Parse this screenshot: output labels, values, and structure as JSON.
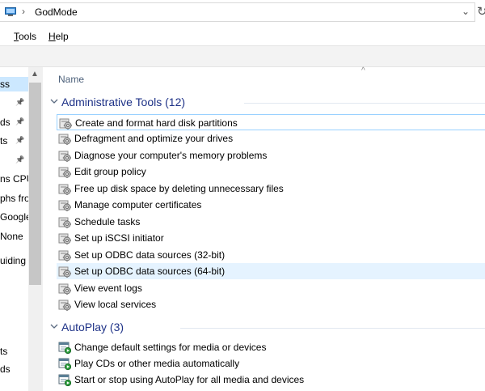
{
  "address": {
    "path": "GodMode"
  },
  "menu": {
    "tools": "Tools",
    "help": "Help"
  },
  "nav": {
    "items": [
      {
        "label": "ss",
        "selected": true,
        "pinned": false
      },
      {
        "label": "",
        "selected": false,
        "pinned": true
      },
      {
        "label": "ds",
        "selected": false,
        "pinned": true
      },
      {
        "label": "ts",
        "selected": false,
        "pinned": true
      },
      {
        "label": "",
        "selected": false,
        "pinned": true
      },
      {
        "label": "ns CPU",
        "selected": false,
        "pinned": false
      },
      {
        "label": "phs fro",
        "selected": false,
        "pinned": false
      },
      {
        "label": "Google",
        "selected": false,
        "pinned": false
      },
      {
        "label": "None",
        "selected": false,
        "pinned": false
      },
      {
        "label": "uiding",
        "selected": false,
        "pinned": false
      },
      {
        "label": "ts",
        "selected": false,
        "pinned": false
      },
      {
        "label": "ds",
        "selected": false,
        "pinned": false
      }
    ]
  },
  "columns": {
    "name": "Name"
  },
  "groups": [
    {
      "title": "Administrative Tools (12)",
      "icon": "admin-tools-icon",
      "items": [
        "Create and format hard disk partitions",
        "Defragment and optimize your drives",
        "Diagnose your computer's memory problems",
        "Edit group policy",
        "Free up disk space by deleting unnecessary files",
        "Manage computer certificates",
        "Schedule tasks",
        "Set up iSCSI initiator",
        "Set up ODBC data sources (32-bit)",
        "Set up ODBC data sources (64-bit)",
        "View event logs",
        "View local services"
      ]
    },
    {
      "title": "AutoPlay (3)",
      "icon": "autoplay-icon",
      "items": [
        "Change default settings for media or devices",
        "Play CDs or other media automatically",
        "Start or stop using AutoPlay for all media and devices"
      ]
    }
  ],
  "colors": {
    "group_title": "#1e3287",
    "selection": "#cce8ff",
    "hover": "#e5f3ff"
  }
}
